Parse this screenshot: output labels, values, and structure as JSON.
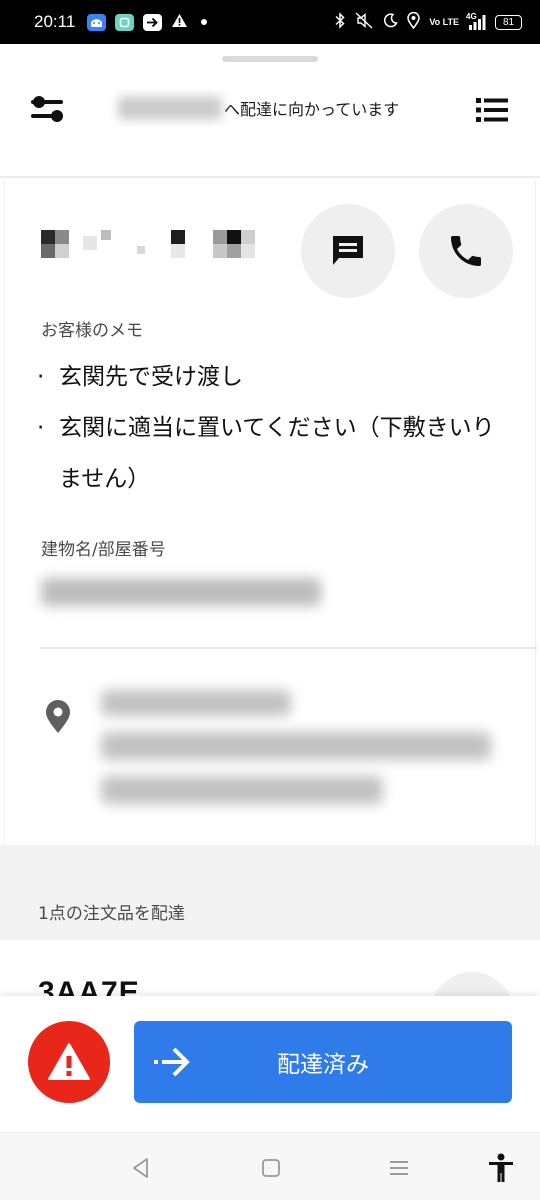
{
  "status_bar": {
    "time": "20:11",
    "network": "4G",
    "volte": "Vo LTE",
    "battery": "81"
  },
  "header": {
    "title_suffix": "へ配達に向かっています"
  },
  "customer": {
    "memo_label": "お客様のメモ",
    "memo_items": [
      "玄関先で受け渡し",
      "玄関に適当に置いてください（下敷きいりません）"
    ],
    "building_label": "建物名/部屋番号"
  },
  "order_section": {
    "items_label": "1点の注文品を配達",
    "order_id": "3AA7E"
  },
  "actions": {
    "delivered_label": "配達済み"
  },
  "colors": {
    "primary_blue": "#2f7bea",
    "alert_red": "#e8261a",
    "circle_bg": "#efefef",
    "section_bg": "#f3f3f3"
  },
  "icons": {
    "filter": "filter-icon",
    "list": "list-icon",
    "message": "message-icon",
    "phone": "phone-icon",
    "location": "location-pin-icon",
    "alert": "warning-icon",
    "arrow": "arrow-right-icon"
  }
}
